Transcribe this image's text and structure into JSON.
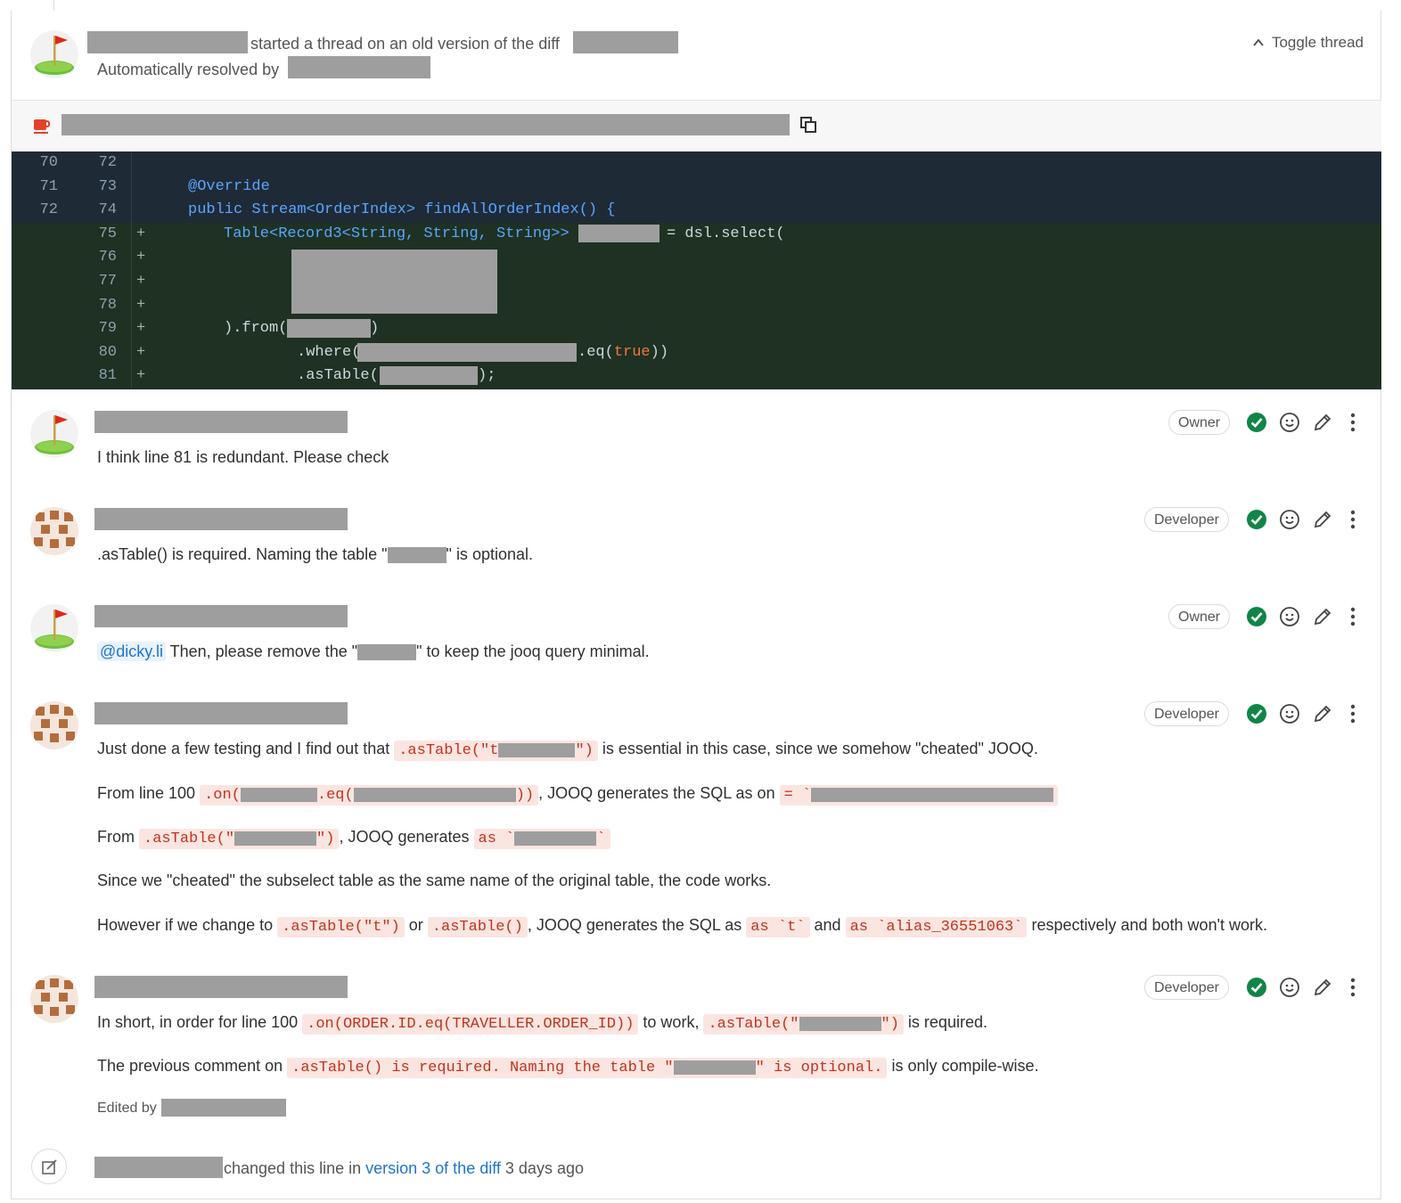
{
  "thread": {
    "started_text": "started a thread on an old version of the diff",
    "resolved_text": "Automatically resolved by",
    "toggle_label": "Toggle thread"
  },
  "code_lines": [
    {
      "old": "70",
      "new": "72",
      "sign": "",
      "type": "ctx"
    },
    {
      "old": "71",
      "new": "73",
      "sign": "",
      "type": "ctx"
    },
    {
      "old": "72",
      "new": "74",
      "sign": "",
      "type": "ctx"
    },
    {
      "old": "",
      "new": "75",
      "sign": "+",
      "type": "add"
    },
    {
      "old": "",
      "new": "76",
      "sign": "+",
      "type": "add"
    },
    {
      "old": "",
      "new": "77",
      "sign": "+",
      "type": "add"
    },
    {
      "old": "",
      "new": "78",
      "sign": "+",
      "type": "add"
    },
    {
      "old": "",
      "new": "79",
      "sign": "+",
      "type": "add"
    },
    {
      "old": "",
      "new": "80",
      "sign": "+",
      "type": "add"
    },
    {
      "old": "",
      "new": "81",
      "sign": "+",
      "type": "add"
    }
  ],
  "code": {
    "l73": "@Override",
    "l74_a": "public",
    "l74_b": "Stream<OrderIndex>",
    "l74_c": "findAllOrderIndex() {",
    "l75_a": "Table<Record3<String, String, String>>",
    "l75_b": "= dsl.select(",
    "l79_a": ").from(",
    "l79_b": ")",
    "l80_a": ".where(",
    "l80_b": ".eq(",
    "l80_c": "true",
    "l80_d": "))",
    "l81_a": ".asTable(",
    "l81_b": ");"
  },
  "comments": [
    {
      "role": "Owner",
      "text": "I think line 81 is redundant. Please check"
    },
    {
      "role": "Developer",
      "text_a": ".asTable() is required. Naming the table \"",
      "text_b": "\" is optional."
    },
    {
      "role": "Owner",
      "mention": "@dicky.li",
      "text_a": "Then, please remove the \"",
      "text_b": "\" to keep the jooq query minimal."
    },
    {
      "role": "Developer",
      "p1_a": "Just done a few testing and I find out that",
      "p1_code_a": ".asTable(\"t",
      "p1_code_b": "\")",
      "p1_b": "is essential in this case, since we somehow \"cheated\" JOOQ.",
      "p2_a": "From line 100",
      "p2_code_a": ".on(",
      "p2_code_b": ".eq(",
      "p2_code_c": "))",
      "p2_b": ", JOOQ generates the SQL as on",
      "p2_code_d": "= `",
      "p3_a": "From",
      "p3_code_a": ".asTable(\"",
      "p3_code_b": "\")",
      "p3_b": ", JOOQ generates",
      "p3_code_c": "as `",
      "p3_code_d": "`",
      "p4": "Since we \"cheated\" the subselect table as the same name of the original table, the code works.",
      "p5_a": "However if we change to",
      "p5_code_a": ".asTable(\"t\")",
      "p5_b": "or",
      "p5_code_b": ".asTable()",
      "p5_c": ", JOOQ generates the SQL as",
      "p5_code_c": "as `t`",
      "p5_d": "and",
      "p5_code_d": "as `alias_36551063`",
      "p5_e": "respectively and both won't work."
    },
    {
      "role": "Developer",
      "p1_a": "In short, in order for line 100",
      "p1_code": ".on(ORDER.ID.eq(TRAVELLER.ORDER_ID))",
      "p1_b": "to work,",
      "p1_code2_a": ".asTable(\"",
      "p1_code2_b": "\")",
      "p1_c": "is required.",
      "p2_a": "The previous comment on",
      "p2_code_a": ".asTable() is required. Naming the table \"",
      "p2_code_b": "\" is optional.",
      "p2_b": "is only compile-wise.",
      "edited": "Edited by"
    }
  ],
  "system_note": {
    "text_a": "changed this line in",
    "link": "version 3 of the diff",
    "text_b": "3 days ago"
  }
}
